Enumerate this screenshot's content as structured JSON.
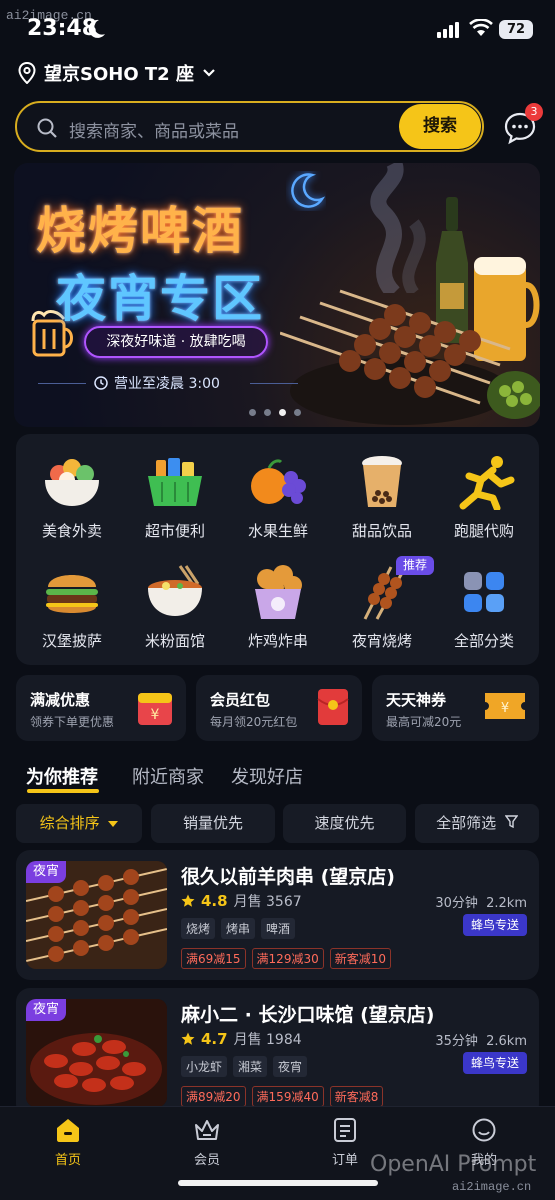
{
  "watermark": {
    "top": "ai2image.cn",
    "bottom_brand": "OpenAI Prompt",
    "bottom_url": "ai2image.cn"
  },
  "status": {
    "time": "23:48",
    "battery": "72"
  },
  "location": {
    "label": "望京SOHO T2 座"
  },
  "search": {
    "placeholder": "搜索商家、商品或菜品",
    "button": "搜索",
    "msg_badge": "3"
  },
  "banner": {
    "title_line1": "烧烤啤酒",
    "title_line2": "夜宵专区",
    "tagline": "深夜好味道 · 放肆吃喝",
    "hours": "营业至凌晨 3:00",
    "dots_active_index": 2
  },
  "categories": [
    {
      "label": "美食外卖",
      "icon": "food-bowl-icon"
    },
    {
      "label": "超市便利",
      "icon": "shopping-basket-icon"
    },
    {
      "label": "水果生鲜",
      "icon": "fruit-icon"
    },
    {
      "label": "甜品饮品",
      "icon": "bubble-tea-icon"
    },
    {
      "label": "跑腿代购",
      "icon": "runner-icon"
    },
    {
      "label": "汉堡披萨",
      "icon": "burger-icon"
    },
    {
      "label": "米粉面馆",
      "icon": "noodle-bowl-icon"
    },
    {
      "label": "炸鸡炸串",
      "icon": "fried-chicken-icon"
    },
    {
      "label": "夜宵烧烤",
      "icon": "skewer-icon"
    },
    {
      "label": "全部分类",
      "icon": "all-categories-icon"
    }
  ],
  "recommend_tag": "推荐",
  "coupons": [
    {
      "title": "满减优惠",
      "sub": "领券下单更优惠",
      "icon": "discount-coupon-icon"
    },
    {
      "title": "会员红包",
      "sub": "每月领20元红包",
      "icon": "red-envelope-icon"
    },
    {
      "title": "天天神券",
      "sub": "最高可减20元",
      "icon": "ticket-icon"
    }
  ],
  "tabs": [
    "为你推荐",
    "附近商家",
    "发现好店"
  ],
  "sort": [
    "综合排序",
    "销量优先",
    "速度优先",
    "全部筛选"
  ],
  "stores": [
    {
      "tag": "夜宵",
      "name": "很久以前羊肉串 (望京店)",
      "rating": "4.8",
      "monthly": "月售 3567",
      "time": "30分钟",
      "distance": "2.2km",
      "tags": [
        "烧烤",
        "烤串",
        "啤酒"
      ],
      "delivery": "蜂鸟专送",
      "promos": [
        "满69减15",
        "满129减30",
        "新客减10"
      ]
    },
    {
      "tag": "夜宵",
      "name": "麻小二 · 长沙口味馆 (望京店)",
      "rating": "4.7",
      "monthly": "月售 1984",
      "time": "35分钟",
      "distance": "2.6km",
      "tags": [
        "小龙虾",
        "湘菜",
        "夜宵"
      ],
      "delivery": "蜂鸟专送",
      "promos": [
        "满89减20",
        "满159减40",
        "新客减8"
      ]
    }
  ],
  "nav": [
    "首页",
    "会员",
    "订单",
    "我的"
  ],
  "colors": {
    "accent": "#f5c518",
    "bg": "#0b0e16",
    "card": "#161a24",
    "delivery": "#3b37c9",
    "promo": "#ff6b5a"
  }
}
